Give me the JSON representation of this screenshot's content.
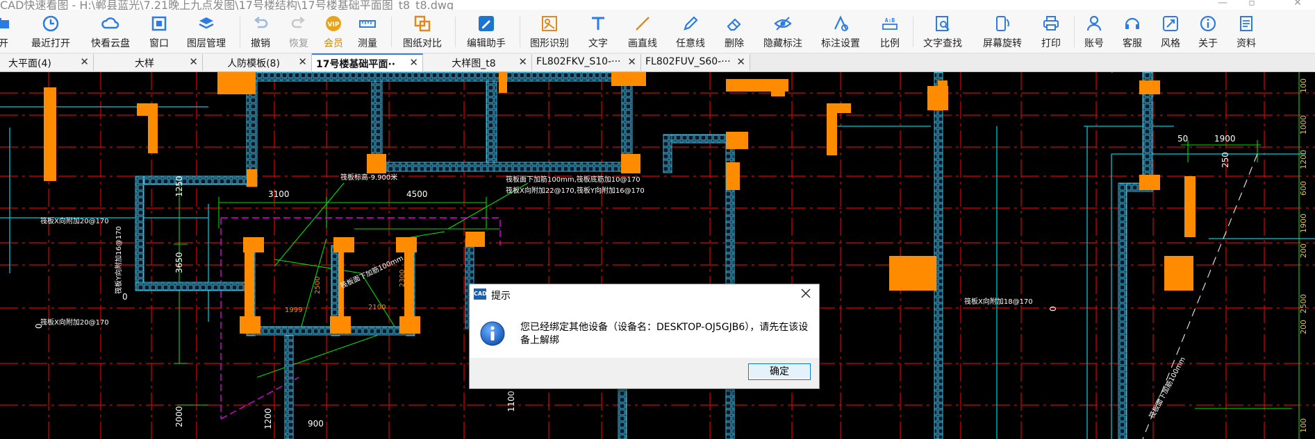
{
  "window": {
    "title": "CAD快速看图 - H:\\郸县蓝光\\7.21晚上九点发图\\17号楼结构\\17号楼基础平面图_t8_t8.dwg"
  },
  "toolbar": {
    "items": [
      {
        "label": "开",
        "icon": "open-folder-icon"
      },
      {
        "label": "最近打开",
        "icon": "recent-clock-icon"
      },
      {
        "label": "快看云盘",
        "icon": "cloud-icon"
      },
      {
        "label": "窗口",
        "icon": "window-icon"
      },
      {
        "label": "图层管理",
        "icon": "layers-icon"
      },
      {
        "label": "撤销",
        "icon": "undo-icon"
      },
      {
        "label": "恢复",
        "icon": "redo-icon"
      },
      {
        "label": "会员",
        "icon": "vip-icon"
      },
      {
        "label": "测量",
        "icon": "measure-ruler-icon"
      },
      {
        "label": "图纸对比",
        "icon": "compare-icon"
      },
      {
        "label": "编辑助手",
        "icon": "edit-assistant-icon"
      },
      {
        "label": "图形识别",
        "icon": "shape-recognize-icon"
      },
      {
        "label": "文字",
        "icon": "text-t-icon"
      },
      {
        "label": "画直线",
        "icon": "line-icon"
      },
      {
        "label": "任意线",
        "icon": "pen-icon"
      },
      {
        "label": "删除",
        "icon": "eraser-icon"
      },
      {
        "label": "隐藏标注",
        "icon": "eye-hide-icon"
      },
      {
        "label": "标注设置",
        "icon": "annotation-settings-icon"
      },
      {
        "label": "比例",
        "icon": "scale-icon"
      },
      {
        "label": "文字查找",
        "icon": "text-search-icon"
      },
      {
        "label": "屏幕旋转",
        "icon": "rotate-screen-icon"
      },
      {
        "label": "打印",
        "icon": "printer-icon"
      },
      {
        "label": "账号",
        "icon": "user-icon"
      },
      {
        "label": "客服",
        "icon": "headset-icon"
      },
      {
        "label": "风格",
        "icon": "style-icon"
      },
      {
        "label": "关于",
        "icon": "info-icon"
      },
      {
        "label": "资料",
        "icon": "document-icon"
      }
    ]
  },
  "tabs": [
    {
      "label": "大平面(4)"
    },
    {
      "label": "大样"
    },
    {
      "label": "人防模板(8)"
    },
    {
      "label": "17号楼基础平面··"
    },
    {
      "label": "大样图_t8"
    },
    {
      "label": "FL802FKV_S10-···"
    },
    {
      "label": "FL802FUV_S60-···"
    }
  ],
  "drawing": {
    "annotations": {
      "a1": "筏板标高-9.900米",
      "a2": "筏板面下加筋100mm,筏板底筋加10@170",
      "a3": "筏板X向附加22@170,筏板Y向附加16@170",
      "a4": "筏板X向附加20@170",
      "a5": "筏板X向附加20@170",
      "a6": "筏板Y向附加16@170",
      "a7": "筏板面下加筋100mm",
      "a8": "筏板X向附加18@170",
      "a9": "筏板面下加筋100mm"
    },
    "dims": {
      "d3100": "3100",
      "d4500": "4500",
      "d1250": "1250",
      "d3650": "3650",
      "d2500": "2500",
      "d2300": "2300",
      "d1999": "1999",
      "d2100": "2100",
      "d2000": "2000",
      "d1200b": "1200",
      "d900": "900",
      "d1100": "1100",
      "d0a": "0",
      "d0b": "0",
      "d0c": "0",
      "d50": "50",
      "d1900a": "1900",
      "d250": "250",
      "r100a": "100",
      "r1000": "1000",
      "r1200": "1200",
      "r600": "600",
      "r1900": "1900",
      "r200a": "200",
      "r2500": "2500",
      "r200b": "200",
      "r100b": "100"
    }
  },
  "dialog": {
    "title": "提示",
    "app_icon_text": "CAD",
    "message": "您已经绑定其他设备（设备名：DESKTOP-OJ5GJB6），请先在该设备上解绑",
    "ok_label": "确定"
  },
  "colors": {
    "accent": "#3b7de0",
    "wall_orange": "#ff8c00",
    "cad_red": "#e00000",
    "cad_cyan": "#00c8d8",
    "cad_green": "#00e000",
    "cad_magenta": "#e000e0"
  }
}
